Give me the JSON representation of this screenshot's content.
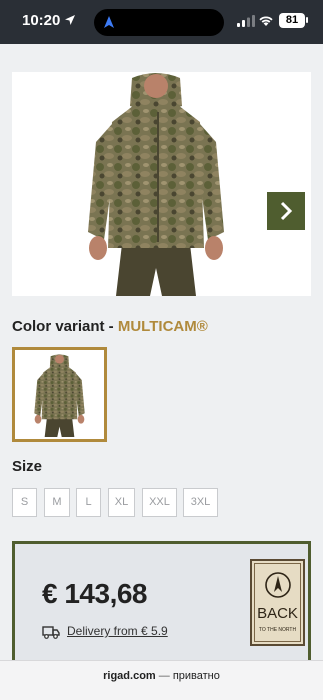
{
  "status_bar": {
    "time": "10:20",
    "battery": "81"
  },
  "product": {
    "variant_label": "Color variant - ",
    "variant_value": "MULTICAM®",
    "size_title": "Size",
    "sizes": [
      "S",
      "M",
      "L",
      "XL",
      "XXL",
      "3XL"
    ],
    "price": "€ 143,68",
    "delivery_link": "Delivery from € 5.9"
  },
  "badge": {
    "back": "BACK",
    "subtitle": "TO THE NORTH"
  },
  "browser": {
    "domain": "rigad.com",
    "separator": " — ",
    "privacy": "приватно"
  },
  "colors": {
    "olive": "#4f5d2f",
    "gold": "#b08a3c",
    "status_bar": "#2a2f36"
  }
}
